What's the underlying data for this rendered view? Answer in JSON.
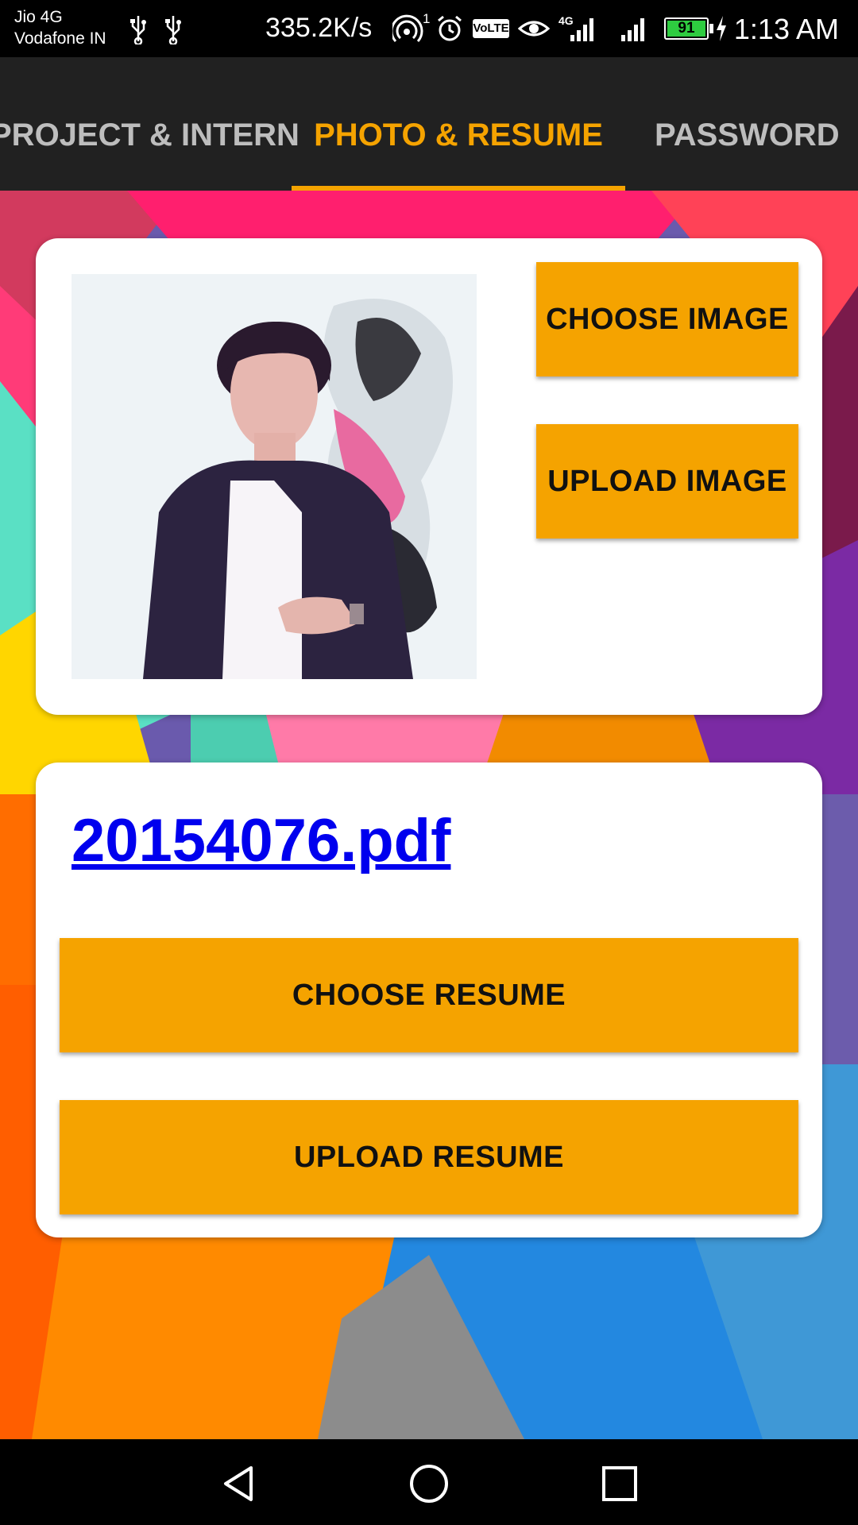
{
  "status_bar": {
    "carrier_1": "Jio 4G",
    "carrier_2": "Vodafone IN",
    "speed": "335.2K/s",
    "hotspot_badge": "1",
    "volte": "VoLTE",
    "network_badge": "4G",
    "battery": "91",
    "time": "1:13 AM"
  },
  "tabs": {
    "items": [
      {
        "label": "PROJECT & INTERN"
      },
      {
        "label": "PHOTO & RESUME"
      },
      {
        "label": "PASSWORD"
      }
    ],
    "active_color": "#f5a300"
  },
  "photo_card": {
    "choose_image_label": "CHOOSE IMAGE",
    "upload_image_label": "UPLOAD IMAGE"
  },
  "resume_card": {
    "file_name": "20154076.pdf",
    "choose_resume_label": "CHOOSE RESUME",
    "upload_resume_label": "UPLOAD RESUME"
  },
  "colors": {
    "accent": "#f5a300",
    "link": "#0000ee",
    "tab_bar": "#212121"
  },
  "icons": [
    "usb-icon",
    "hotspot-icon",
    "alarm-icon",
    "eye-icon",
    "signal-icon",
    "battery-icon",
    "charging-icon",
    "back-icon",
    "home-icon",
    "recents-icon"
  ]
}
